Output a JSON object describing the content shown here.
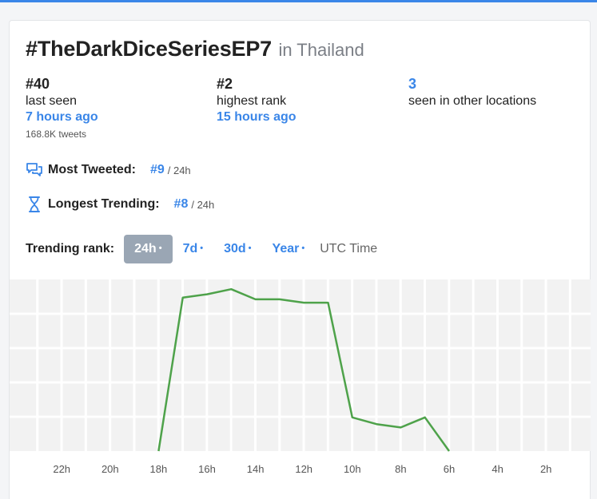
{
  "header": {
    "hashtag": "#TheDarkDiceSeriesEP7",
    "location": "in Thailand"
  },
  "stats": {
    "last_seen": {
      "rank": "#40",
      "label": "last seen",
      "ago": "7 hours ago",
      "tweets": "168.8K tweets"
    },
    "highest": {
      "rank": "#2",
      "label": "highest rank",
      "ago": "15 hours ago"
    },
    "other": {
      "count": "3",
      "label": "seen in other locations"
    }
  },
  "metrics": {
    "most_tweeted": {
      "label": "Most Tweeted:",
      "rank": "#9",
      "period": "/ 24h",
      "icon": "chat-bubbles-icon"
    },
    "longest_trending": {
      "label": "Longest Trending:",
      "rank": "#8",
      "period": "/ 24h",
      "icon": "hourglass-icon"
    }
  },
  "trending": {
    "label": "Trending rank:",
    "tabs": [
      {
        "label": "24h",
        "active": true
      },
      {
        "label": "7d",
        "active": false
      },
      {
        "label": "30d",
        "active": false
      },
      {
        "label": "Year",
        "active": false
      }
    ],
    "tab_dot": "•",
    "utc": "UTC Time"
  },
  "colors": {
    "accent": "#3a86e8",
    "line": "#4ea24a",
    "grid_bg": "#f2f2f2"
  },
  "chart_data": {
    "type": "line",
    "xlabel": "",
    "ylabel": "",
    "x_ticks": [
      "22h",
      "20h",
      "18h",
      "16h",
      "14h",
      "12h",
      "10h",
      "8h",
      "6h",
      "4h",
      "2h"
    ],
    "x_tick_hours_ago": [
      22,
      20,
      18,
      16,
      14,
      12,
      10,
      8,
      6,
      4,
      2
    ],
    "xlim_hours_ago": [
      24,
      0
    ],
    "ylim_rank": [
      1,
      50
    ],
    "y_reversed": true,
    "grid": true,
    "series": [
      {
        "hours_ago": [
          18,
          17,
          16,
          15,
          14,
          13,
          12,
          11,
          10,
          9,
          8,
          7,
          6
        ],
        "rank": [
          50,
          4.5,
          3.5,
          2,
          5,
          5,
          6,
          6,
          40,
          42,
          43,
          40,
          50
        ]
      }
    ]
  }
}
